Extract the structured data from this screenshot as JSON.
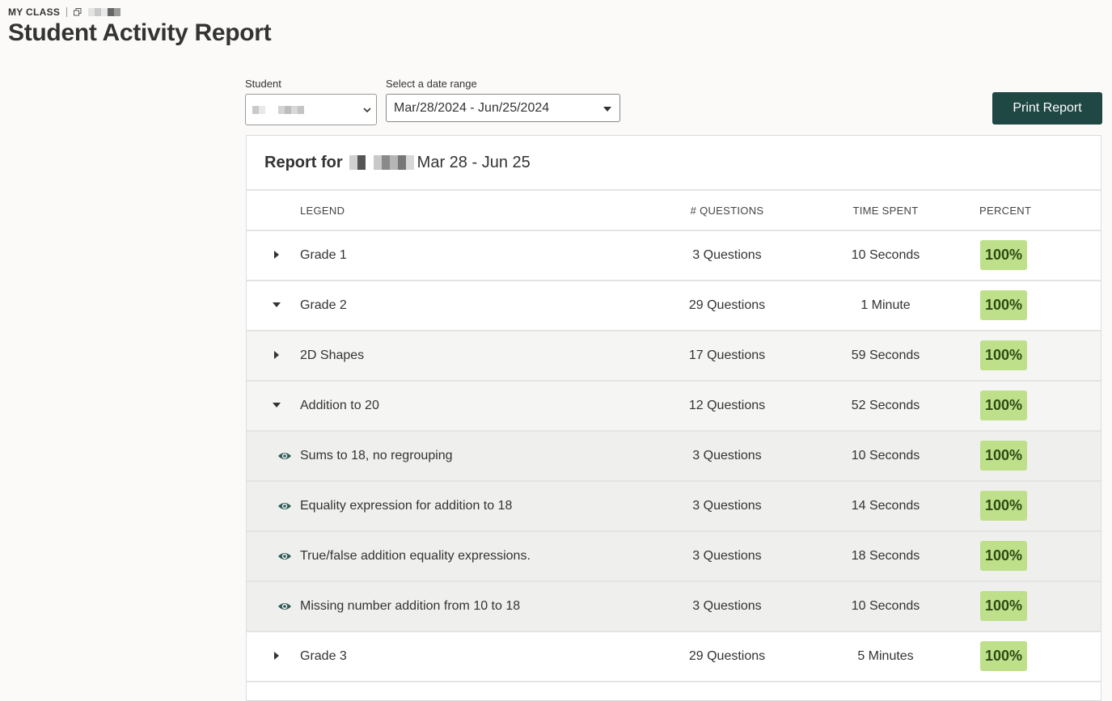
{
  "header": {
    "breadcrumb": "MY CLASS",
    "title": "Student Activity Report"
  },
  "filters": {
    "student_label": "Student",
    "date_label": "Select a date range",
    "date_value": "Mar/28/2024 - Jun/25/2024"
  },
  "toolbar": {
    "print_label": "Print Report"
  },
  "report": {
    "title_prefix": "Report for",
    "date_span": "Mar 28 - Jun 25",
    "columns": {
      "legend": "LEGEND",
      "questions": "# QUESTIONS",
      "time": "TIME SPENT",
      "percent": "PERCENT"
    },
    "rows": [
      {
        "name": "Grade 1",
        "questions": "3 Questions",
        "time": "10 Seconds",
        "percent": "100%",
        "state": "collapsed"
      },
      {
        "name": "Grade 2",
        "questions": "29 Questions",
        "time": "1 Minute",
        "percent": "100%",
        "state": "expanded"
      },
      {
        "name": "2D Shapes",
        "questions": "17 Questions",
        "time": "59 Seconds",
        "percent": "100%",
        "state": "collapsed"
      },
      {
        "name": "Addition to 20",
        "questions": "12 Questions",
        "time": "52 Seconds",
        "percent": "100%",
        "state": "expanded"
      },
      {
        "name": "Sums to 18, no regrouping",
        "questions": "3 Questions",
        "time": "10 Seconds",
        "percent": "100%",
        "state": "skill"
      },
      {
        "name": "Equality expression for addition to 18",
        "questions": "3 Questions",
        "time": "14 Seconds",
        "percent": "100%",
        "state": "skill"
      },
      {
        "name": "True/false addition equality expressions.",
        "questions": "3 Questions",
        "time": "18 Seconds",
        "percent": "100%",
        "state": "skill"
      },
      {
        "name": "Missing number addition from 10 to 18",
        "questions": "3 Questions",
        "time": "10 Seconds",
        "percent": "100%",
        "state": "skill"
      },
      {
        "name": "Grade 3",
        "questions": "29 Questions",
        "time": "5 Minutes",
        "percent": "100%",
        "state": "collapsed"
      }
    ]
  },
  "colors": {
    "accent": "#1f4844",
    "percent_badge": "#bfe08a",
    "eye_icon": "#2d5a55"
  }
}
